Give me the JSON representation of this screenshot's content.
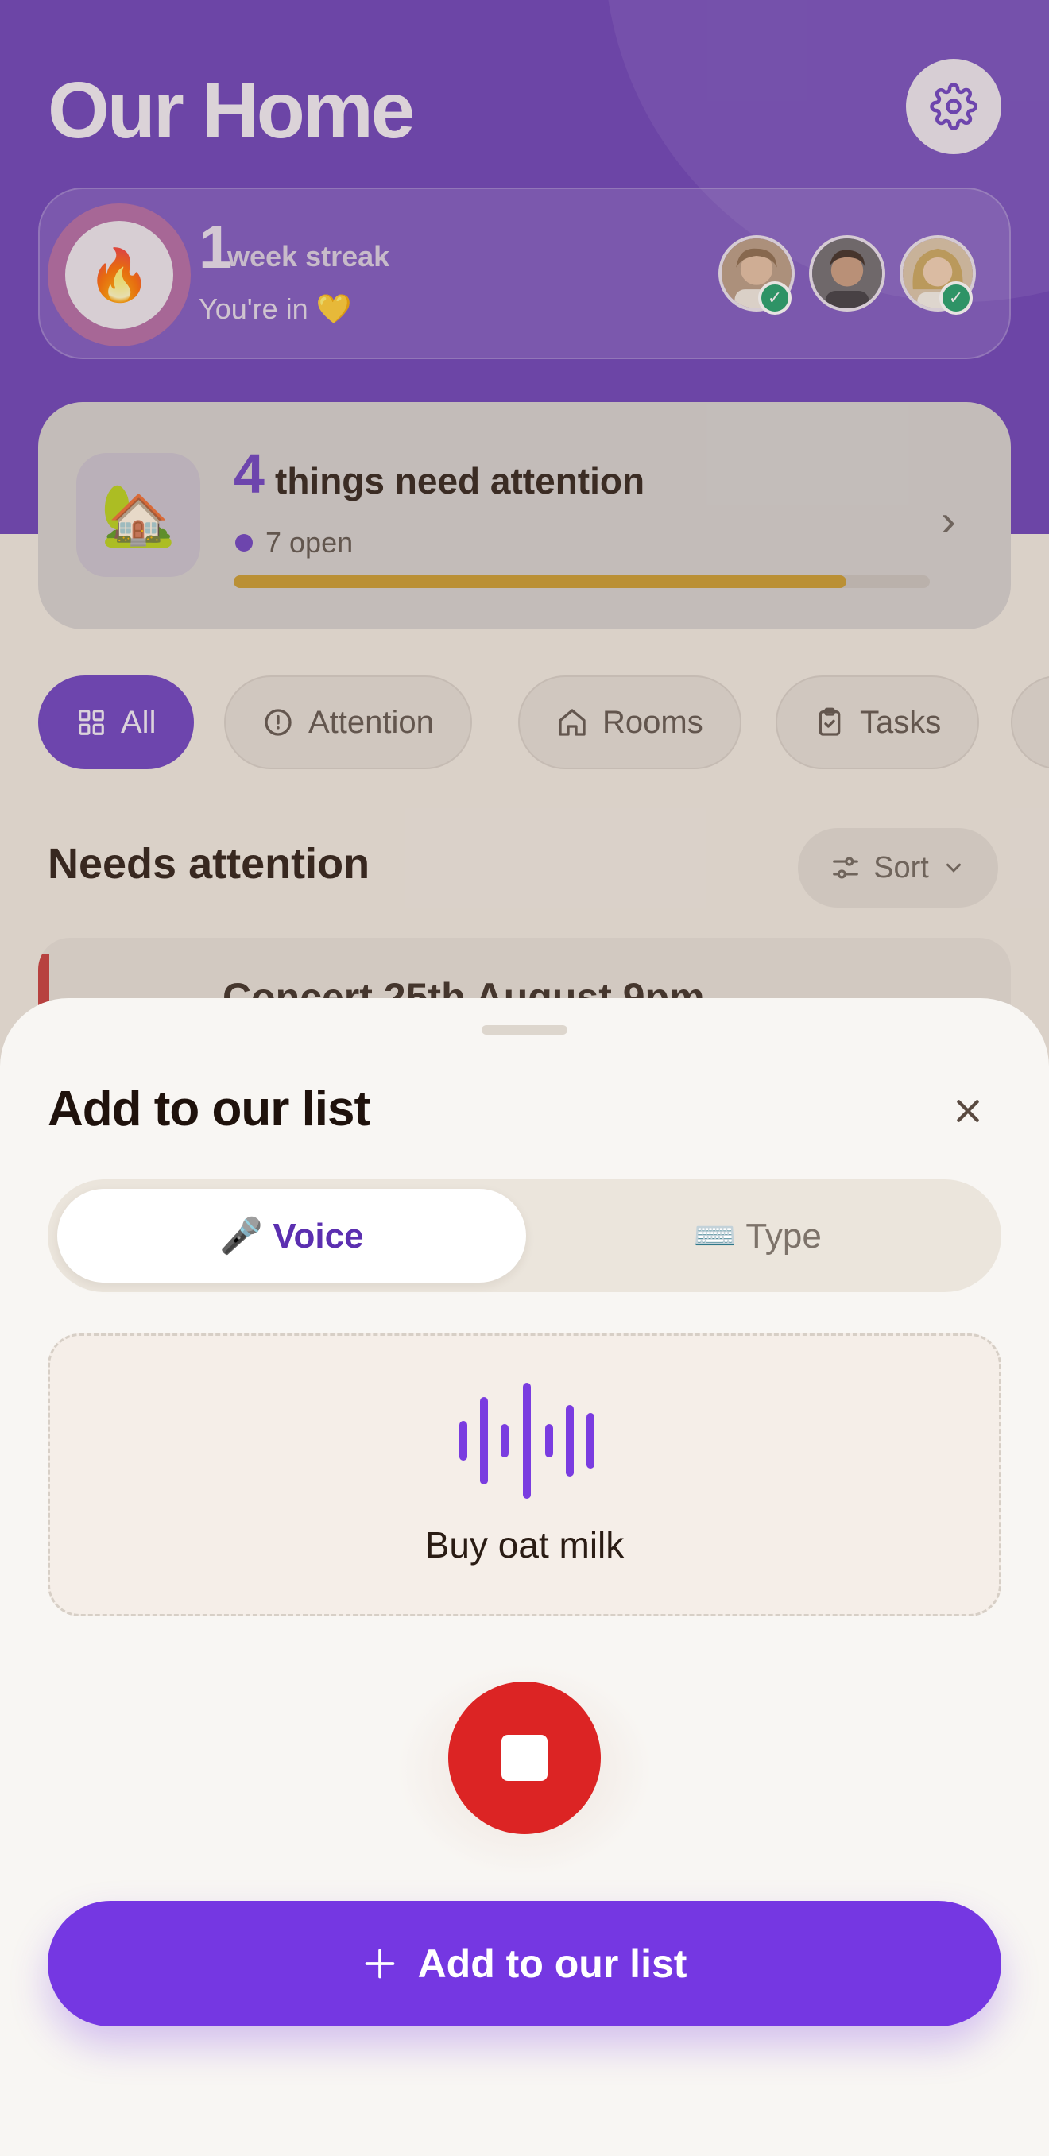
{
  "app": {
    "title": "Our Home",
    "streak": {
      "number": "1",
      "unit": "week streak",
      "subtitle": "You're in 💛"
    },
    "attention": {
      "icon": "🏡",
      "count": "4",
      "label": "things need attention",
      "open_text": "7 open",
      "progress": 0.88
    },
    "chips": [
      {
        "label": "All",
        "icon": "grid-icon",
        "active": true
      },
      {
        "label": "Attention",
        "icon": "alert-circle-icon",
        "active": false
      },
      {
        "label": "Rooms",
        "icon": "home-icon",
        "active": false
      },
      {
        "label": "Tasks",
        "icon": "clipboard-check-icon",
        "active": false
      }
    ],
    "section_title": "Needs attention",
    "sort_label": "Sort",
    "event_text": "Concert 25th August 9pm"
  },
  "sheet": {
    "title": "Add to our list",
    "mode_voice": "🎤 Voice",
    "mode_type": "⌨️ Type",
    "transcript": "Buy oat milk",
    "cta_label": "Add to our list"
  },
  "colors": {
    "brand_purple": "#7537e2",
    "header_purple": "#6a3fb8",
    "stop_red": "#dc2424",
    "progress_gold": "#c99a2e",
    "check_green": "#1e9e6a"
  }
}
